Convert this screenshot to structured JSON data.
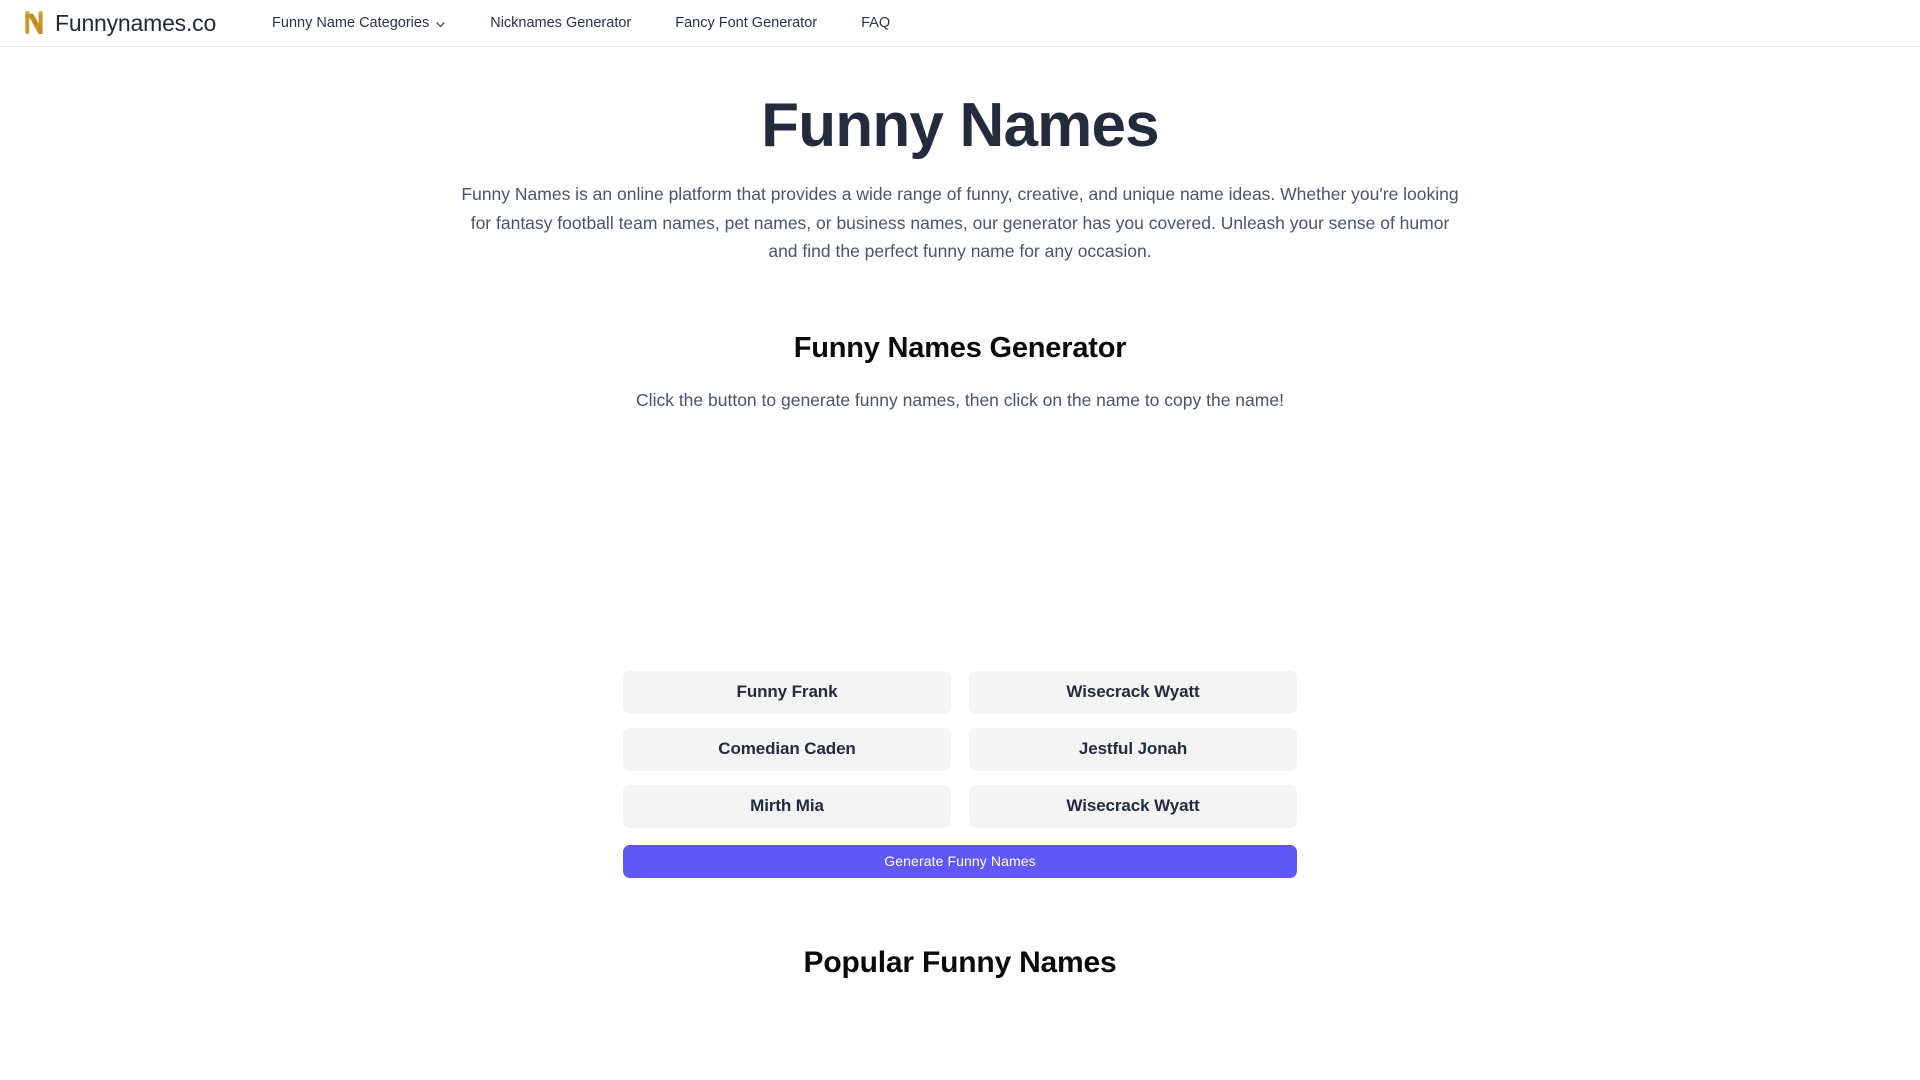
{
  "header": {
    "logo_icon": "letter-n-logo-icon",
    "brand_name": "Funnynames.co",
    "brand_accent_color": "#c29a2e",
    "nav": [
      {
        "label": "Funny Name Categories",
        "has_dropdown": true,
        "icon": "chevron-down-icon"
      },
      {
        "label": "Nicknames Generator",
        "has_dropdown": false
      },
      {
        "label": "Fancy Font Generator",
        "has_dropdown": false
      },
      {
        "label": "FAQ",
        "has_dropdown": false
      }
    ]
  },
  "hero": {
    "title": "Funny Names",
    "description": "Funny Names is an online platform that provides a wide range of funny, creative, and unique name ideas. Whether you're looking for fantasy football team names, pet names, or business names, our generator has you covered. Unleash your sense of humor and find the perfect funny name for any occasion."
  },
  "generator": {
    "title": "Funny Names Generator",
    "hint": "Click the button to generate funny names, then click on the name to copy the name!",
    "names": [
      "Funny Frank",
      "Wisecrack Wyatt",
      "Comedian Caden",
      "Jestful Jonah",
      "Mirth Mia",
      "Wisecrack Wyatt"
    ],
    "generate_label": "Generate Funny Names",
    "generate_color": "#6058f5",
    "card_color": "#f4f4f4"
  },
  "popular": {
    "title": "Popular Funny Names"
  }
}
